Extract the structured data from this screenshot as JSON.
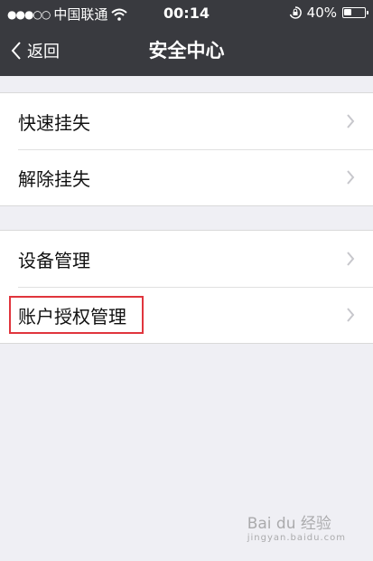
{
  "status_bar": {
    "carrier": "中国联通",
    "time": "00:14",
    "battery_percent": "40%",
    "battery_level": 0.4
  },
  "nav": {
    "back_label": "返回",
    "title": "安全中心"
  },
  "groups": [
    {
      "items": [
        {
          "label": "快速挂失"
        },
        {
          "label": "解除挂失"
        }
      ]
    },
    {
      "items": [
        {
          "label": "设备管理"
        },
        {
          "label": "账户授权管理"
        }
      ]
    }
  ],
  "highlighted_item": "账户授权管理",
  "watermark": {
    "text": "Bai du 经验",
    "sub": "jingyan.baidu.com"
  },
  "colors": {
    "header_bg": "#393a3f",
    "page_bg": "#efeff4",
    "highlight": "#e0353d"
  },
  "icons": [
    "signal-dots-icon",
    "wifi-icon",
    "rotation-lock-icon",
    "battery-icon",
    "back-chevron-icon",
    "chevron-right-icon"
  ]
}
